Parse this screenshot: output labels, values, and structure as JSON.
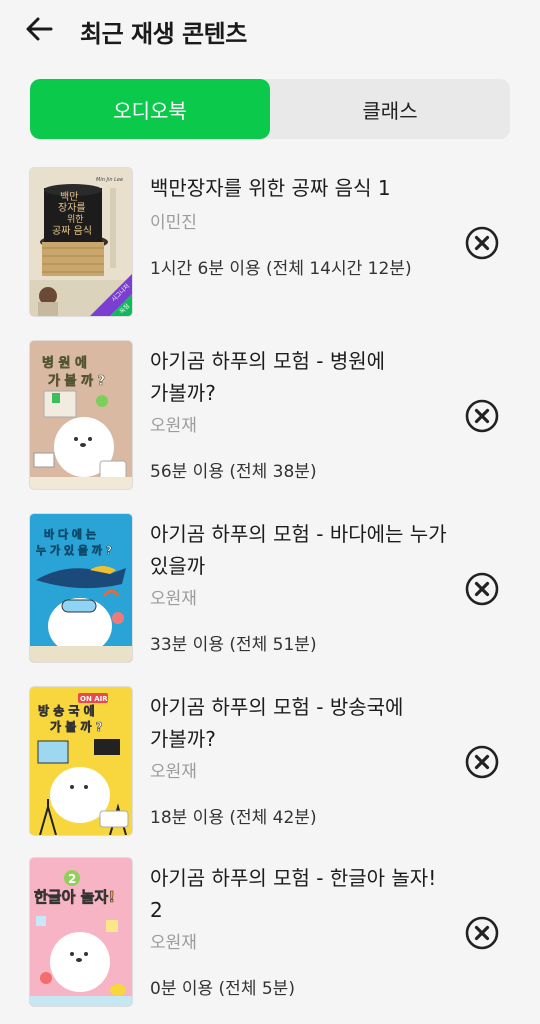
{
  "header": {
    "title": "최근 재생 콘텐츠",
    "back_icon": "arrow-left-icon"
  },
  "tabs": [
    {
      "label": "오디오북",
      "active": true
    },
    {
      "label": "클래스",
      "active": false
    }
  ],
  "colors": {
    "accent": "#0bc94b",
    "background": "#f5f5f5"
  },
  "items": [
    {
      "title_lines": [
        "백만장자를 위한 공짜 음식 1"
      ],
      "author": "이민진",
      "usage": "1시간 6분 이용 (전체 14시간 12분)",
      "cover": {
        "top_text": "Min Jin Lee",
        "title_text": [
          "백만",
          "장자를",
          "위한",
          "공짜 음식"
        ],
        "badge": "시그니처",
        "badge2": "독점"
      }
    },
    {
      "title_lines": [
        "아기곰 하푸의 모험 - 병원에",
        "가볼까?"
      ],
      "author": "오원재",
      "usage": "56분 이용 (전체 38분)",
      "cover": {
        "title_text": [
          "병 원 에",
          "가 볼 까 ?"
        ]
      }
    },
    {
      "title_lines": [
        "아기곰 하푸의 모험 - 바다에는 누가",
        "있을까"
      ],
      "author": "오원재",
      "usage": "33분 이용 (전체 51분)",
      "cover": {
        "title_text": [
          "바 다 에 는",
          "누 가  있 을 까 ?"
        ]
      }
    },
    {
      "title_lines": [
        "아기곰 하푸의 모험 - 방송국에",
        "가볼까?"
      ],
      "author": "오원재",
      "usage": "18분 이용 (전체 42분)",
      "cover": {
        "top_text": "ON AIR",
        "title_text": [
          "방 송 국 에",
          "가 볼 까 ?"
        ]
      }
    },
    {
      "title_lines": [
        "아기곰 하푸의 모험 - 한글아 놀자!",
        "2"
      ],
      "author": "오원재",
      "usage": "0분 이용 (전체 5분)",
      "cover": {
        "top_text": "2",
        "title_text": [
          "한글아 놀자!"
        ]
      }
    }
  ]
}
